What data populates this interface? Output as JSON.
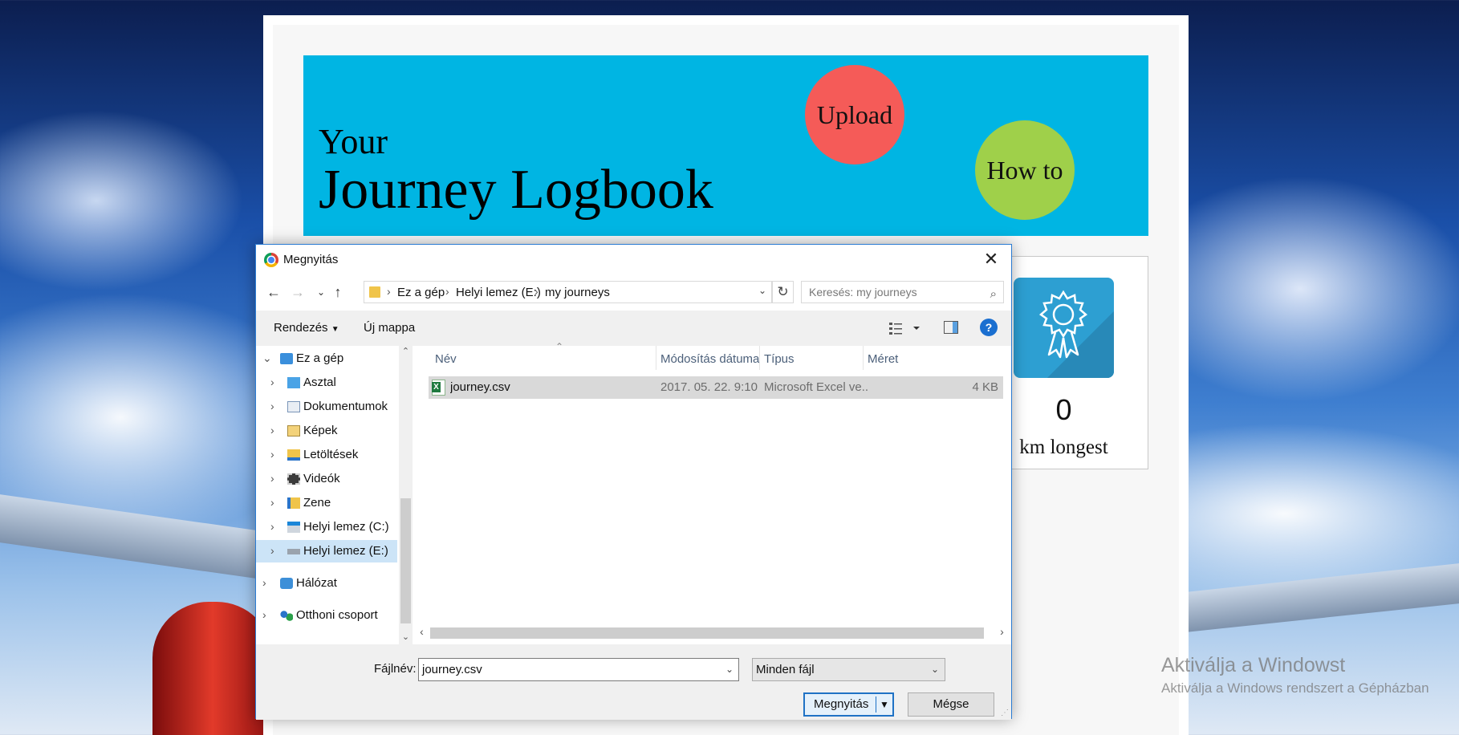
{
  "banner": {
    "line1": "Your",
    "title": "Journey Logbook",
    "upload_label": "Upload",
    "howto_label": "How to"
  },
  "stat": {
    "value": "0",
    "label": "km longest",
    "icon": "award-ribbon-icon"
  },
  "watermark": {
    "line1": "Aktiválja a Windowst",
    "line2": "Aktiválja a Windows rendszert a Gépházban"
  },
  "dialog": {
    "title": "Megnyitás",
    "breadcrumb": [
      "Ez a gép",
      "Helyi lemez (E:)",
      "my journeys"
    ],
    "search_placeholder": "Keresés: my journeys",
    "toolbar": {
      "organize": "Rendezés",
      "new_folder": "Új mappa",
      "help": "?"
    },
    "tree": [
      {
        "label": "Ez a gép",
        "icon": "computer-icon",
        "expanded": true
      },
      {
        "label": "Asztal",
        "icon": "desktop-folder-icon"
      },
      {
        "label": "Dokumentumok",
        "icon": "documents-folder-icon"
      },
      {
        "label": "Képek",
        "icon": "pictures-folder-icon"
      },
      {
        "label": "Letöltések",
        "icon": "downloads-folder-icon"
      },
      {
        "label": "Videók",
        "icon": "videos-folder-icon"
      },
      {
        "label": "Zene",
        "icon": "music-folder-icon"
      },
      {
        "label": "Helyi lemez (C:)",
        "icon": "windows-drive-icon"
      },
      {
        "label": "Helyi lemez (E:)",
        "icon": "drive-icon",
        "selected": true
      },
      {
        "label": "Hálózat",
        "icon": "network-icon"
      },
      {
        "label": "Otthoni csoport",
        "icon": "homegroup-icon"
      }
    ],
    "columns": [
      "Név",
      "Módosítás dátuma",
      "Típus",
      "Méret"
    ],
    "files": [
      {
        "name": "journey.csv",
        "modified": "2017. 05. 22. 9:10",
        "type": "Microsoft Excel ve...",
        "size": "4 KB",
        "icon": "excel-csv-icon"
      }
    ],
    "filename_label": "Fájlnév:",
    "filename_value": "journey.csv",
    "filetype": "Minden fájl",
    "open_label": "Megnyitás",
    "cancel_label": "Mégse"
  },
  "colors": {
    "banner": "#00b5e3",
    "upload": "#f55b58",
    "howto": "#9fd04a",
    "award_tile": "#2d9fd2",
    "selection": "#cce4f7"
  }
}
